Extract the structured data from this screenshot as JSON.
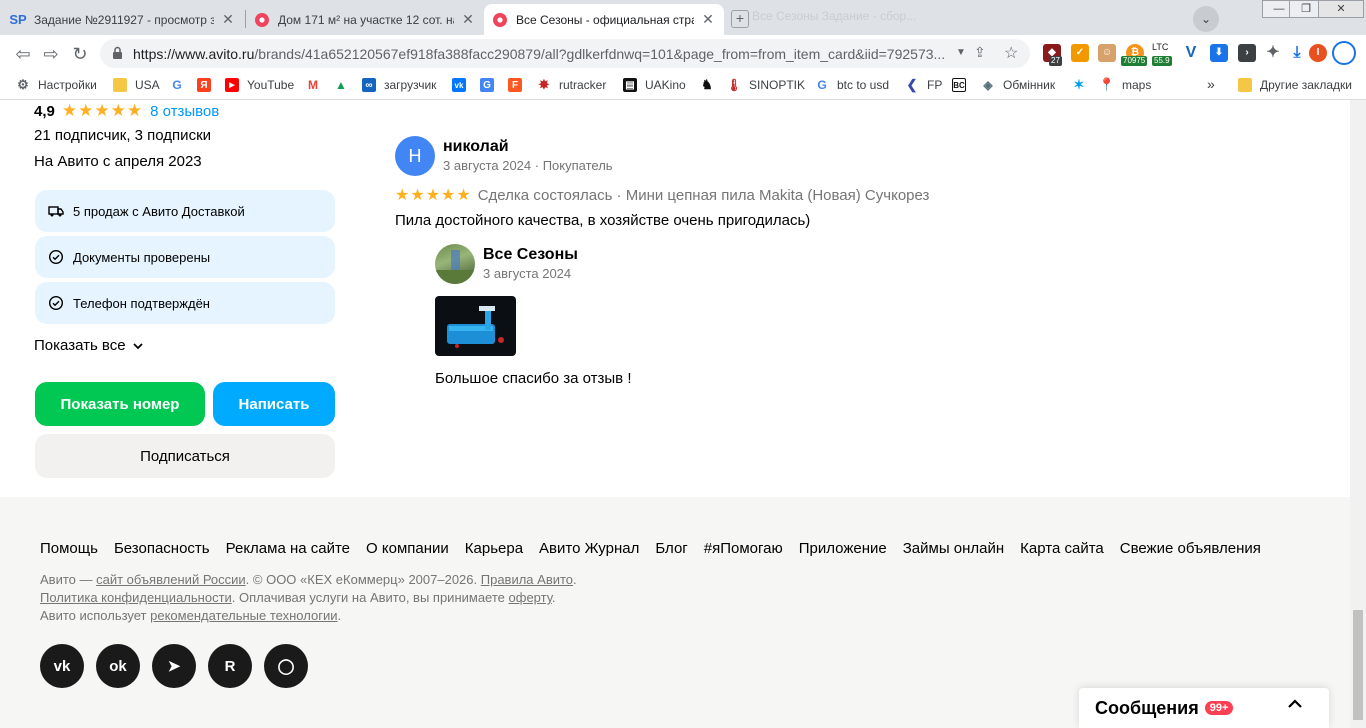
{
  "browser": {
    "tabs": [
      {
        "title": "Задание №2911927 - просмотр з",
        "favicon": "SP",
        "close": "✕"
      },
      {
        "title": "Дом 171 м² на участке 12 сот. на",
        "favicon": "avito",
        "close": "✕"
      },
      {
        "title": "Все Сезоны - официальная стран",
        "favicon": "avito",
        "close": "✕"
      }
    ],
    "new_tab": "+",
    "ghost_tabs": "Все Сезоны      Задание - сбор...",
    "window_controls": {
      "minimize": "—",
      "maximize": "❐",
      "close": "✕"
    },
    "url": {
      "host": "https://www.avito.ru",
      "rest": "/brands/41a652120567ef918fa388facc290879/all?gdlkerfdnwq=101&page_from=from_item_card&iid=792573..."
    },
    "extensions": {
      "ext1_badge": "27",
      "ltc_label": "LTC",
      "ltc_value": "55.9",
      "btc_value": "70975",
      "profile_letter": "I"
    },
    "bookmarks": [
      {
        "label": "Настройки",
        "icon": "gear-icon"
      },
      {
        "label": "USA",
        "icon": "folder-icon"
      },
      {
        "label": "",
        "icon": "google-icon"
      },
      {
        "label": "",
        "icon": "yandex-icon"
      },
      {
        "label": "YouTube",
        "icon": "youtube-icon"
      },
      {
        "label": "",
        "icon": "gmail-icon"
      },
      {
        "label": "",
        "icon": "drive-icon"
      },
      {
        "label": "загрузчик",
        "icon": "loader-icon"
      },
      {
        "label": "",
        "icon": "vk-icon"
      },
      {
        "label": "",
        "icon": "translate-icon"
      },
      {
        "label": "",
        "icon": "f-icon"
      },
      {
        "label": "rutracker",
        "icon": "rutracker-icon"
      },
      {
        "label": "UAKino",
        "icon": "uakino-icon"
      },
      {
        "label": "",
        "icon": "chess-icon"
      },
      {
        "label": "SINOPTIK",
        "icon": "thermometer-icon"
      },
      {
        "label": "btc to usd",
        "icon": "google-icon"
      },
      {
        "label": "FP",
        "icon": "fp-icon"
      },
      {
        "label": "",
        "icon": "bc-icon"
      },
      {
        "label": "Обмінник",
        "icon": "exchange-icon"
      },
      {
        "label": "",
        "icon": "star-icon"
      },
      {
        "label": "maps",
        "icon": "maps-icon"
      }
    ],
    "bookmarks_more": "»",
    "other_bookmarks": "Другие закладки"
  },
  "seller": {
    "rating": "4,9",
    "stars": "★★★★★",
    "reviews_link": "8 отзывов",
    "subscribers": "21 подписчик, 3 подписки",
    "since": "На Авито с апреля 2023",
    "badges": [
      {
        "label": "5 продаж с Авито Доставкой",
        "icon": "truck-icon"
      },
      {
        "label": "Документы проверены",
        "icon": "check-circle-icon"
      },
      {
        "label": "Телефон подтверждён",
        "icon": "check-circle-icon"
      }
    ],
    "show_all": "Показать все",
    "buttons": {
      "show_number": "Показать номер",
      "write": "Написать",
      "subscribe": "Подписаться"
    }
  },
  "review": {
    "avatar_letter": "Н",
    "author": "николай",
    "meta": "3 августа 2024 · Покупатель",
    "stars": "★★★★★",
    "deal": "Сделка состоялась · Мини цепная пила Makita (Новая) Сучкорез",
    "text": "Пила достойного качества, в хозяйстве очень пригодилась)",
    "reply": {
      "author": "Все Сезоны",
      "date": "3 августа 2024",
      "text": "Большое спасибо за отзыв !"
    }
  },
  "footer": {
    "links": [
      "Помощь",
      "Безопасность",
      "Реклама на сайте",
      "О компании",
      "Карьера",
      "Авито Журнал",
      "Блог",
      "#яПомогаю",
      "Приложение",
      "Займы онлайн",
      "Карта сайта",
      "Свежие объявления"
    ],
    "legal1_pre": "Авито — ",
    "legal1_link1": "сайт объявлений России",
    "legal1_mid": ". © ООО «КЕХ еКоммерц» 2007–2026. ",
    "legal1_link2": "Правила Авито",
    "legal1_end": ".",
    "legal2_link1": "Политика конфиденциальности",
    "legal2_mid": ". Оплачивая услуги на Авито, вы принимаете ",
    "legal2_link2": "оферту",
    "legal2_end": ".",
    "legal3_pre": "Авито использует ",
    "legal3_link": "рекомендательные технологии",
    "legal3_end": ".",
    "social": [
      {
        "name": "vk",
        "glyph": "vk"
      },
      {
        "name": "odnoklassniki",
        "glyph": "ok"
      },
      {
        "name": "telegram",
        "glyph": "➤"
      },
      {
        "name": "rutube",
        "glyph": "R"
      },
      {
        "name": "max",
        "glyph": "◯"
      }
    ]
  },
  "messages_widget": {
    "label": "Сообщения",
    "count": "99+",
    "chevron": "⌃"
  },
  "colors": {
    "accent_blue": "#00aaff",
    "green": "#00c853",
    "star": "#ffb021",
    "link": "#0099f7",
    "badge_bg": "#e6f4ff"
  }
}
